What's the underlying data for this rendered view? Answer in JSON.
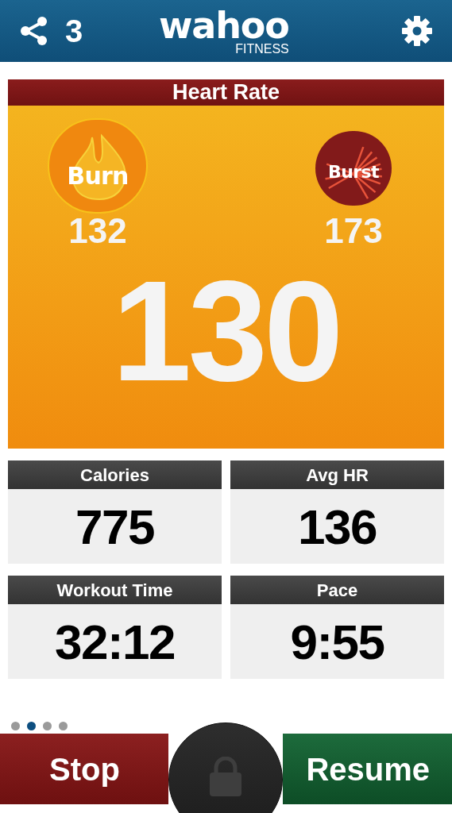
{
  "header": {
    "share_count": "3",
    "logo": {
      "name": "wahoo",
      "sub": "FITNESS"
    }
  },
  "heart_rate": {
    "title": "Heart Rate",
    "value": "130",
    "zones": [
      {
        "kind": "burn",
        "label": "Burn",
        "value": "132"
      },
      {
        "kind": "burst",
        "label": "Burst",
        "value": "173"
      }
    ]
  },
  "tiles": [
    {
      "label": "Calories",
      "value": "775"
    },
    {
      "label": "Avg HR",
      "value": "136"
    },
    {
      "label": "Workout Time",
      "value": "32:12"
    },
    {
      "label": "Pace",
      "value": "9:55"
    }
  ],
  "pages": [
    {
      "selected": false
    },
    {
      "selected": true
    },
    {
      "selected": false
    },
    {
      "selected": false
    }
  ],
  "controls": {
    "stop": "Stop",
    "resume": "Resume"
  }
}
